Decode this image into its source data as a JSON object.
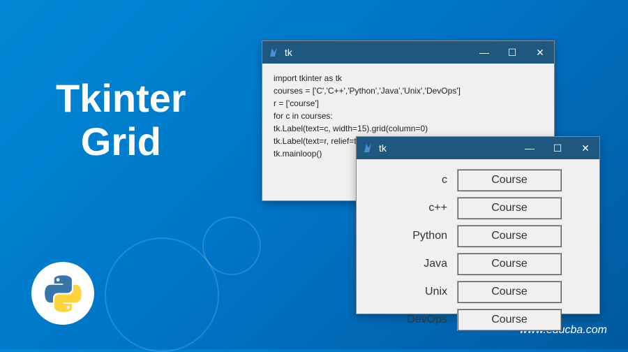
{
  "title_line1": "Tkinter",
  "title_line2": "Grid",
  "watermark": "www.educba.com",
  "window1": {
    "title": "tk",
    "code": {
      "l1": "import tkinter as tk",
      "l2": "courses = ['C','C++','Python','Java','Unix','DevOps']",
      "l3": "r = ['course']",
      "l4": "for c in courses:",
      "l5": "tk.Label(text=c, width=15).grid(column=0)",
      "l6": "tk.Label(text=r, relief=tk.RIDGE, width=15).grid(column=1)",
      "l7": "tk.mainloop()"
    }
  },
  "window2": {
    "title": "tk",
    "rows": [
      {
        "col0": "c",
        "col1": "Course"
      },
      {
        "col0": "c++",
        "col1": "Course"
      },
      {
        "col0": "Python",
        "col1": "Course"
      },
      {
        "col0": "Java",
        "col1": "Course"
      },
      {
        "col0": "Unix",
        "col1": "Course"
      },
      {
        "col0": "DevOps",
        "col1": "Course"
      }
    ]
  },
  "icons": {
    "minimize": "—",
    "maximize": "☐",
    "close": "✕"
  }
}
